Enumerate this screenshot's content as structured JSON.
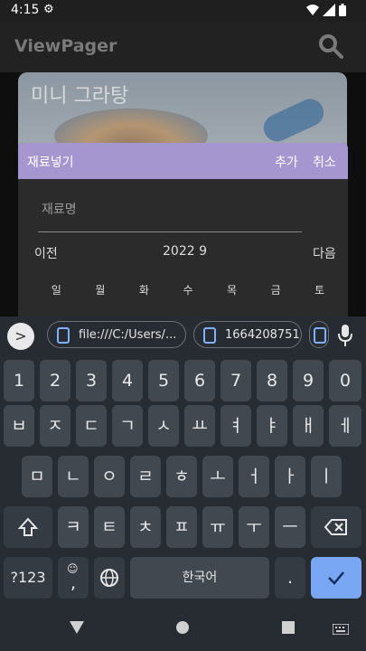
{
  "status": {
    "time": "4:15"
  },
  "appbar": {
    "title": "ViewPager"
  },
  "card": {
    "title": "미니 그라탕"
  },
  "dialog": {
    "title": "재료넣기",
    "add": "추가",
    "cancel": "취소",
    "ingredient_placeholder": "재료명",
    "prev": "이전",
    "month": "2022 9",
    "next": "다음",
    "weekdays": [
      "일",
      "월",
      "화",
      "수",
      "목",
      "금",
      "토"
    ]
  },
  "keyboard": {
    "clipboard_chips": [
      "file:///C:/Users/...",
      "1664208751"
    ],
    "row_numbers": [
      "1",
      "2",
      "3",
      "4",
      "5",
      "6",
      "7",
      "8",
      "9",
      "0"
    ],
    "row1": [
      "ㅂ",
      "ㅈ",
      "ㄷ",
      "ㄱ",
      "ㅅ",
      "ㅛ",
      "ㅕ",
      "ㅑ",
      "ㅐ",
      "ㅔ"
    ],
    "row2": [
      "ㅁ",
      "ㄴ",
      "ㅇ",
      "ㄹ",
      "ㅎ",
      "ㅗ",
      "ㅓ",
      "ㅏ",
      "ㅣ"
    ],
    "row3": [
      "ㅋ",
      "ㅌ",
      "ㅊ",
      "ㅍ",
      "ㅠ",
      "ㅜ",
      "ㅡ"
    ],
    "symbols": "?123",
    "comma": ",",
    "space": "한국어",
    "period": "."
  },
  "colors": {
    "dialog_header": "#a596cf",
    "enter_key": "#7aa7f4",
    "keyboard_bg": "#262c31"
  }
}
